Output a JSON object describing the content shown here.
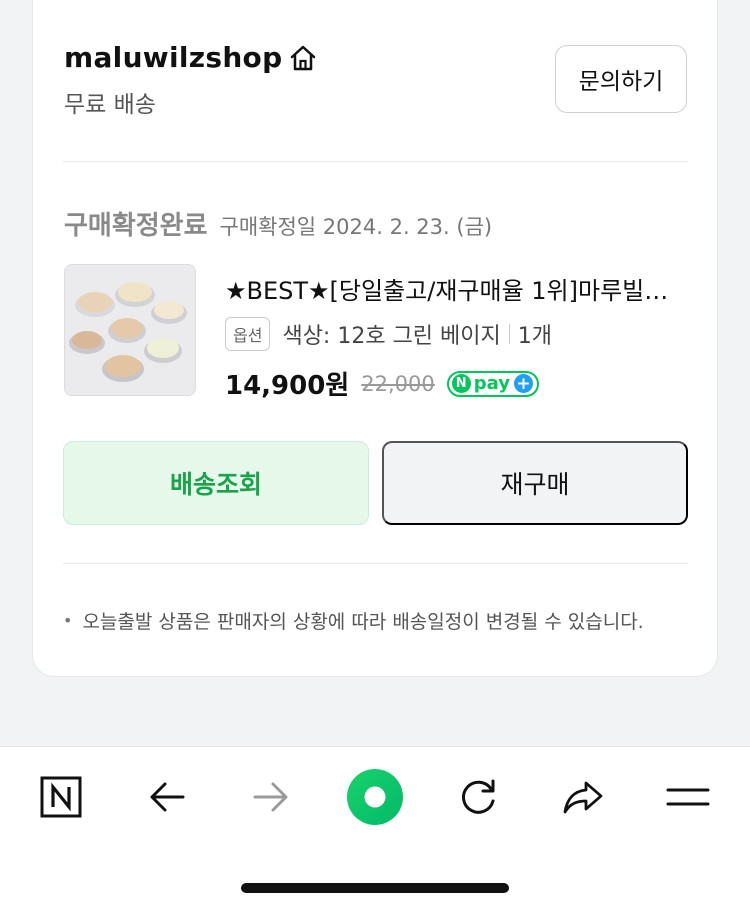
{
  "shop": {
    "name": "maluwilzshop",
    "shipping": "무료 배송",
    "inquiry_label": "문의하기"
  },
  "order": {
    "status": "구매확정완료",
    "confirmed_date": "구매확정일 2024. 2. 23. (금)"
  },
  "product": {
    "title": "★BEST★[당일출고/재구매율 1위]마루빌…",
    "option_badge": "옵션",
    "option_text": "색상: 12호 그린 베이지",
    "quantity": "1개",
    "price": "14,900원",
    "original_price": "22,000",
    "npay_label": "pay"
  },
  "actions": {
    "track_label": "배송조회",
    "rebuy_label": "재구매"
  },
  "notice": "오늘출발 상품은 판매자의 상황에 따라 배송일정이 변경될 수 있습니다.",
  "colors": {
    "naver_green": "#03c75a",
    "track_bg": "#e5f8ea",
    "track_text": "#1aa34a"
  },
  "toolbar": {
    "items": [
      "naver-home-icon",
      "back-arrow-icon",
      "forward-arrow-icon",
      "green-dot-icon",
      "refresh-icon",
      "share-icon",
      "menu-icon"
    ]
  }
}
